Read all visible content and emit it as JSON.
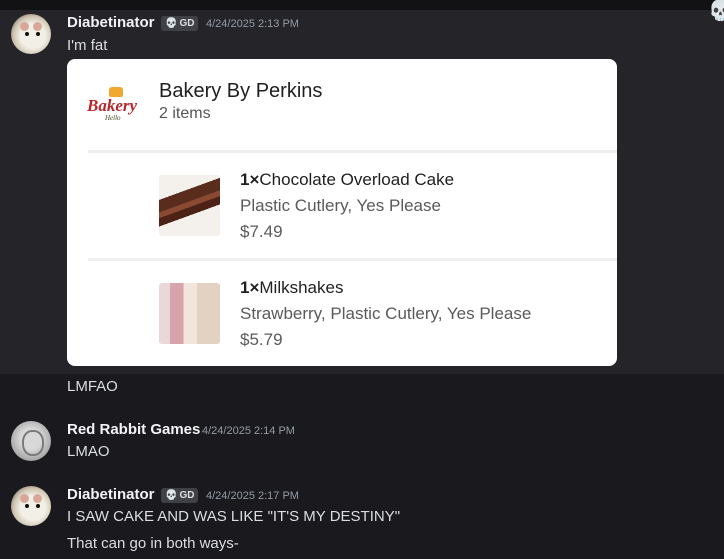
{
  "messages": [
    {
      "username": "Diabetinator",
      "tag": "GD",
      "timestamp": "4/24/2025 2:13 PM",
      "lines": [
        "I'm fat"
      ]
    },
    {
      "username": "Red Rabbit Games",
      "timestamp": "4/24/2025 2:14 PM",
      "lines": [
        "LMAO"
      ]
    },
    {
      "username": "Diabetinator",
      "tag": "GD",
      "timestamp": "4/24/2025 2:17 PM",
      "lines": [
        "I SAW CAKE AND WAS LIKE \"IT'S MY DESTINY\"",
        "That can go in both ways-"
      ]
    }
  ],
  "continuation": "LMFAO",
  "order_card": {
    "store_name": "Bakery By Perkins",
    "item_count": "2 items",
    "logo_text": "Bakery",
    "logo_script": "Hello",
    "items": [
      {
        "qty": "1×",
        "name": "Chocolate Overload Cake",
        "options": "Plastic Cutlery, Yes Please",
        "price": "$7.49"
      },
      {
        "qty": "1×",
        "name": "Milkshakes",
        "options": "Strawberry, Plastic Cutlery, Yes Please",
        "price": "$5.79"
      }
    ]
  },
  "icons": {
    "tag_icon": "skull-icon",
    "corner_icon": "skull-icon"
  }
}
